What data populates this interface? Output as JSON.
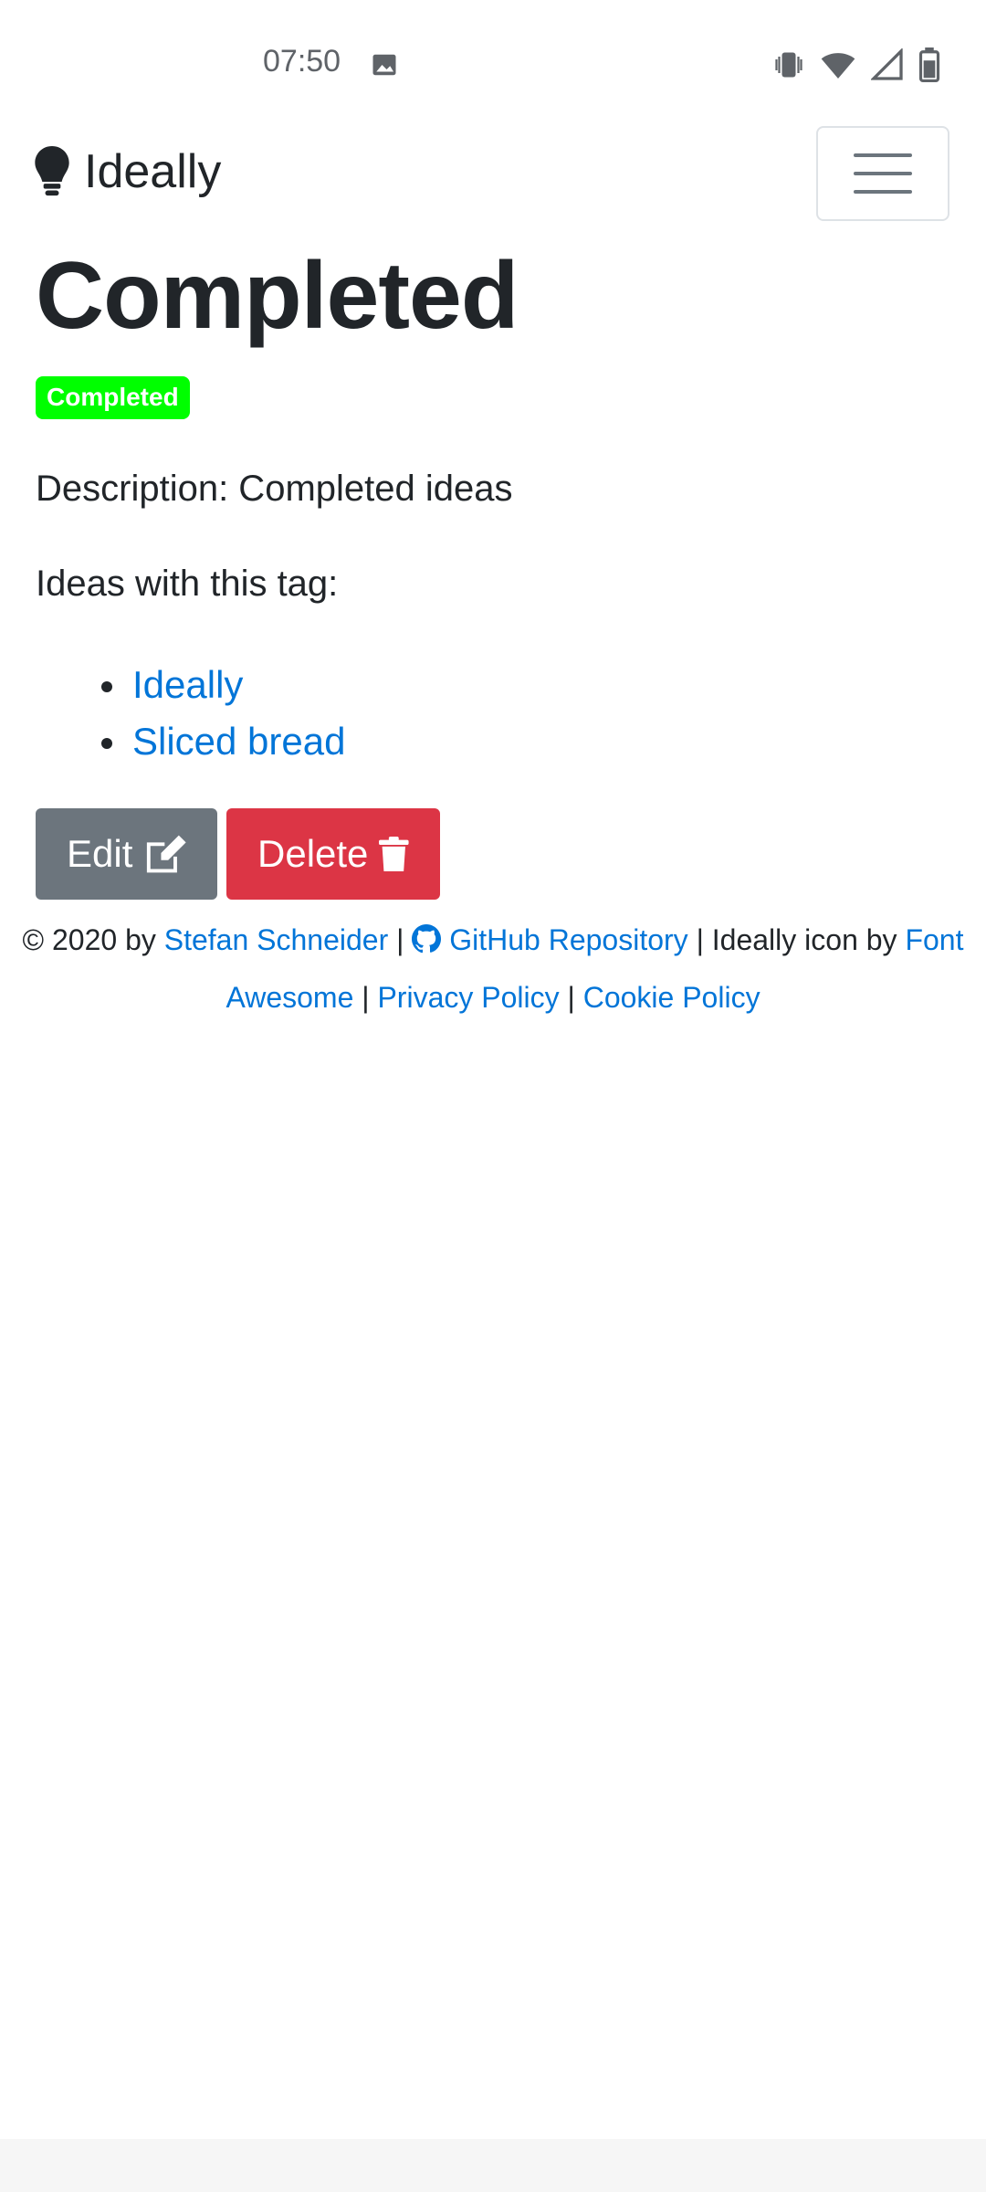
{
  "status_bar": {
    "time": "07:50",
    "icons": [
      "image-icon",
      "vibrate-icon",
      "wifi-icon",
      "signal-icon",
      "battery-icon"
    ]
  },
  "navbar": {
    "brand": "Ideally",
    "brand_icon": "lightbulb-icon",
    "menu_icon": "hamburger-menu-icon"
  },
  "page": {
    "title": "Completed",
    "badge": "Completed",
    "badge_color": "#00ff00",
    "description": "Description: Completed ideas",
    "ideas_heading": "Ideas with this tag:",
    "ideas": [
      "Ideally",
      "Sliced bread"
    ]
  },
  "buttons": {
    "edit": "Edit",
    "edit_icon": "edit-icon",
    "delete": "Delete",
    "delete_icon": "trash-icon"
  },
  "footer": {
    "copyright": "© 2020 by",
    "author": "Stefan Schneider",
    "sep1": "|",
    "github_icon": "github-icon",
    "github": "GitHub Repository",
    "icon_credit": "| Ideally icon by",
    "font_awesome": "Font Awesome",
    "sep2": "|",
    "privacy": "Privacy Policy",
    "sep3": "|",
    "cookie": "Cookie Policy"
  },
  "colors": {
    "link": "#0275d8",
    "edit_button": "#6c757d",
    "delete_button": "#dc3545"
  }
}
